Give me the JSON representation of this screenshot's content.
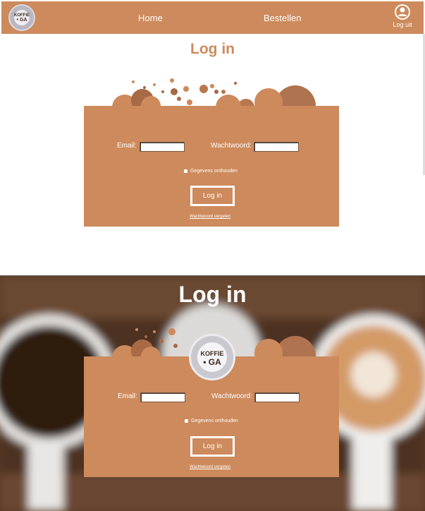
{
  "nav": {
    "logo_line1": "KOFFIE",
    "logo_line2": "• GA",
    "links": [
      "Home",
      "Bestellen"
    ],
    "logout_label": "Log uit"
  },
  "login": {
    "title": "Log in",
    "email_label": "Email:",
    "email_value": "",
    "password_label": "Wachtwoord:",
    "password_value": "",
    "remember_label": "Gegevens onthouden",
    "submit_label": "Log in",
    "forgot_label": "Wachtwoord vergeten"
  },
  "colors": {
    "accent": "#cd8a5c",
    "bubble_dark": "#a86a44",
    "bubble_mid": "#b97750"
  }
}
